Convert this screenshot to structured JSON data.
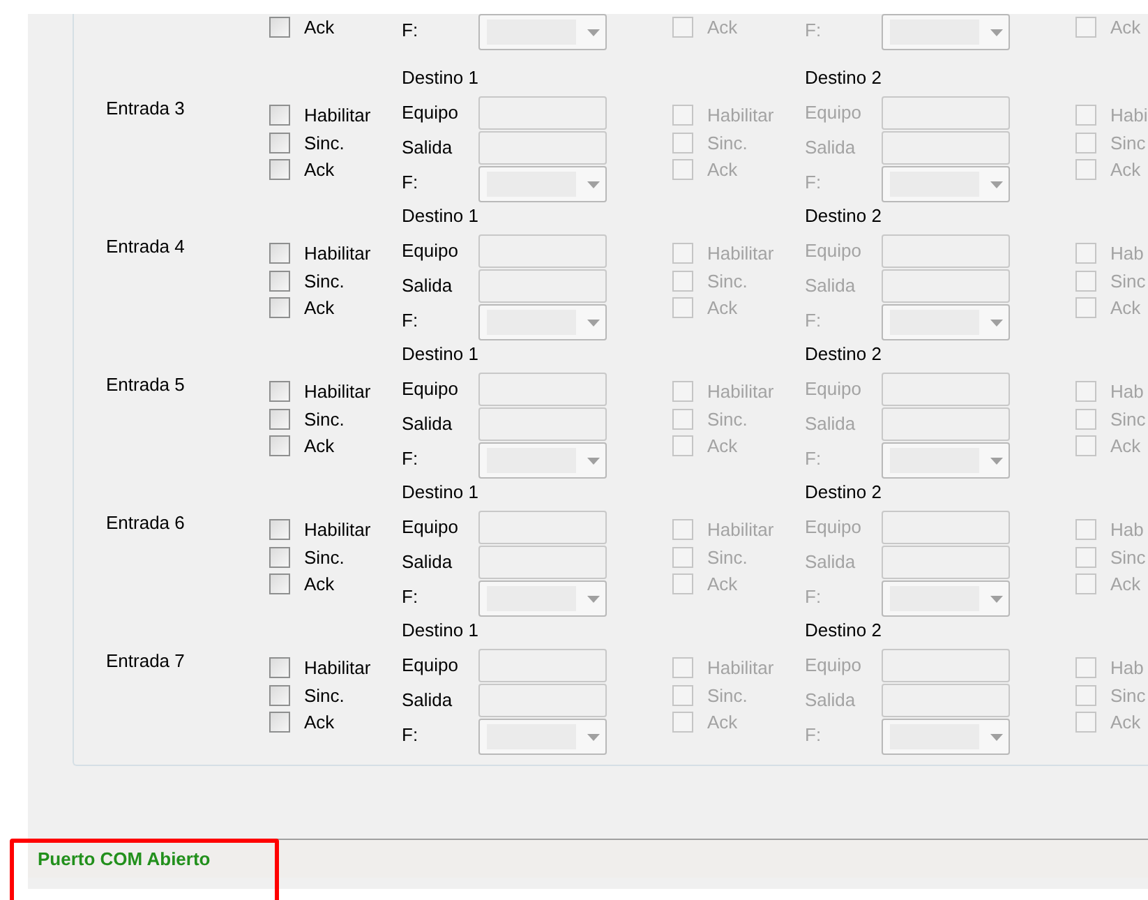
{
  "entries": [
    {
      "kind": "partial",
      "destinos": [
        {
          "disabled": false,
          "options": [
            {
              "label": "Ack",
              "checked": false
            }
          ],
          "fields": [
            {
              "kind": "combo",
              "label": "F:"
            }
          ]
        },
        {
          "disabled": true,
          "options": [
            {
              "label": "Ack",
              "checked": false
            }
          ],
          "fields": [
            {
              "kind": "combo",
              "label": "F:"
            }
          ]
        },
        {
          "disabled": true,
          "options": [
            {
              "label": "Ack",
              "checked": false
            }
          ]
        }
      ]
    },
    {
      "kind": "full",
      "label": "Entrada 3",
      "destinos": [
        {
          "header": "Destino 1",
          "disabled": false,
          "options": [
            {
              "label": "Habilitar",
              "checked": false
            },
            {
              "label": "Sinc.",
              "checked": false
            },
            {
              "label": "Ack",
              "checked": false
            }
          ],
          "fields": [
            {
              "kind": "text",
              "label": "Equipo"
            },
            {
              "kind": "text",
              "label": "Salida"
            },
            {
              "kind": "combo",
              "label": "F:"
            }
          ]
        },
        {
          "header": "Destino 2",
          "disabled": true,
          "options": [
            {
              "label": "Habilitar",
              "checked": false
            },
            {
              "label": "Sinc.",
              "checked": false
            },
            {
              "label": "Ack",
              "checked": false
            }
          ],
          "fields": [
            {
              "kind": "text",
              "label": "Equipo"
            },
            {
              "kind": "text",
              "label": "Salida"
            },
            {
              "kind": "combo",
              "label": "F:"
            }
          ]
        },
        {
          "disabled": true,
          "options": [
            {
              "label": "Habi",
              "checked": false
            },
            {
              "label": "Sinc",
              "checked": false
            },
            {
              "label": "Ack",
              "checked": false
            }
          ]
        }
      ]
    },
    {
      "kind": "full",
      "label": "Entrada 4",
      "destinos": [
        {
          "header": "Destino 1",
          "disabled": false,
          "options": [
            {
              "label": "Habilitar",
              "checked": false
            },
            {
              "label": "Sinc.",
              "checked": false
            },
            {
              "label": "Ack",
              "checked": false
            }
          ],
          "fields": [
            {
              "kind": "text",
              "label": "Equipo"
            },
            {
              "kind": "text",
              "label": "Salida"
            },
            {
              "kind": "combo",
              "label": "F:"
            }
          ]
        },
        {
          "header": "Destino 2",
          "disabled": true,
          "options": [
            {
              "label": "Habilitar",
              "checked": false
            },
            {
              "label": "Sinc.",
              "checked": false
            },
            {
              "label": "Ack",
              "checked": false
            }
          ],
          "fields": [
            {
              "kind": "text",
              "label": "Equipo"
            },
            {
              "kind": "text",
              "label": "Salida"
            },
            {
              "kind": "combo",
              "label": "F:"
            }
          ]
        },
        {
          "disabled": true,
          "options": [
            {
              "label": "Hab",
              "checked": false
            },
            {
              "label": "Sinc",
              "checked": false
            },
            {
              "label": "Ack",
              "checked": false
            }
          ]
        }
      ]
    },
    {
      "kind": "full",
      "label": "Entrada 5",
      "destinos": [
        {
          "header": "Destino 1",
          "disabled": false,
          "options": [
            {
              "label": "Habilitar",
              "checked": false
            },
            {
              "label": "Sinc.",
              "checked": false
            },
            {
              "label": "Ack",
              "checked": false
            }
          ],
          "fields": [
            {
              "kind": "text",
              "label": "Equipo"
            },
            {
              "kind": "text",
              "label": "Salida"
            },
            {
              "kind": "combo",
              "label": "F:"
            }
          ]
        },
        {
          "header": "Destino 2",
          "disabled": true,
          "options": [
            {
              "label": "Habilitar",
              "checked": false
            },
            {
              "label": "Sinc.",
              "checked": false
            },
            {
              "label": "Ack",
              "checked": false
            }
          ],
          "fields": [
            {
              "kind": "text",
              "label": "Equipo"
            },
            {
              "kind": "text",
              "label": "Salida"
            },
            {
              "kind": "combo",
              "label": "F:"
            }
          ]
        },
        {
          "disabled": true,
          "options": [
            {
              "label": "Hab",
              "checked": false
            },
            {
              "label": "Sinc",
              "checked": false
            },
            {
              "label": "Ack",
              "checked": false
            }
          ]
        }
      ]
    },
    {
      "kind": "full",
      "label": "Entrada 6",
      "destinos": [
        {
          "header": "Destino 1",
          "disabled": false,
          "options": [
            {
              "label": "Habilitar",
              "checked": false
            },
            {
              "label": "Sinc.",
              "checked": false
            },
            {
              "label": "Ack",
              "checked": false
            }
          ],
          "fields": [
            {
              "kind": "text",
              "label": "Equipo"
            },
            {
              "kind": "text",
              "label": "Salida"
            },
            {
              "kind": "combo",
              "label": "F:"
            }
          ]
        },
        {
          "header": "Destino 2",
          "disabled": true,
          "options": [
            {
              "label": "Habilitar",
              "checked": false
            },
            {
              "label": "Sinc.",
              "checked": false
            },
            {
              "label": "Ack",
              "checked": false
            }
          ],
          "fields": [
            {
              "kind": "text",
              "label": "Equipo"
            },
            {
              "kind": "text",
              "label": "Salida"
            },
            {
              "kind": "combo",
              "label": "F:"
            }
          ]
        },
        {
          "disabled": true,
          "options": [
            {
              "label": "Hab",
              "checked": false
            },
            {
              "label": "Sinc",
              "checked": false
            },
            {
              "label": "Ack",
              "checked": false
            }
          ]
        }
      ]
    },
    {
      "kind": "full",
      "label": "Entrada 7",
      "destinos": [
        {
          "header": "Destino 1",
          "disabled": false,
          "options": [
            {
              "label": "Habilitar",
              "checked": false
            },
            {
              "label": "Sinc.",
              "checked": false
            },
            {
              "label": "Ack",
              "checked": false
            }
          ],
          "fields": [
            {
              "kind": "text",
              "label": "Equipo"
            },
            {
              "kind": "text",
              "label": "Salida"
            },
            {
              "kind": "combo",
              "label": "F:"
            }
          ]
        },
        {
          "header": "Destino 2",
          "disabled": true,
          "options": [
            {
              "label": "Habilitar",
              "checked": false
            },
            {
              "label": "Sinc.",
              "checked": false
            },
            {
              "label": "Ack",
              "checked": false
            }
          ],
          "fields": [
            {
              "kind": "text",
              "label": "Equipo"
            },
            {
              "kind": "text",
              "label": "Salida"
            },
            {
              "kind": "combo",
              "label": "F:"
            }
          ]
        },
        {
          "disabled": true,
          "options": [
            {
              "label": "Hab",
              "checked": false
            },
            {
              "label": "Sinc",
              "checked": false
            },
            {
              "label": "Ack",
              "checked": false
            }
          ]
        }
      ]
    }
  ],
  "status_bar": {
    "text": "Puerto COM Abierto"
  }
}
